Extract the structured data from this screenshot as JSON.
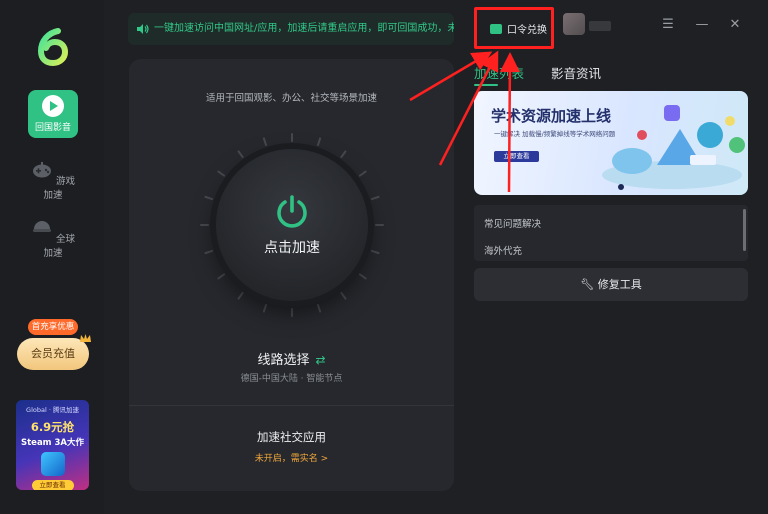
{
  "sidebar": {
    "items": [
      {
        "label": "回国影音",
        "icon": "play-icon",
        "active": true
      },
      {
        "label": "游戏加速",
        "icon": "gamepad-icon",
        "active": false
      },
      {
        "label": "全球加速",
        "icon": "globe-icon",
        "active": false
      }
    ],
    "promo_badge": "首充享优惠",
    "vip_button": "会员充值",
    "ad": {
      "brand": "Global · 腾讯加速",
      "price": "6.9元抢",
      "title": "Steam 3A大作",
      "cta": "立即查看"
    }
  },
  "notice": "一键加速访问中国网址/应用，加速后请重启应用，即可回国成功，未开启",
  "main": {
    "scenario": "适用于回国观影、办公、社交等场景加速",
    "power_label": "点击加速",
    "route_title": "线路选择",
    "route_sub": "德国-中国大陆 · 智能节点",
    "social_title": "加速社交应用",
    "social_sub": "未开启，需实名 >"
  },
  "header": {
    "redeem": "口令兑换",
    "window_buttons": {
      "menu": "☰",
      "minimize": "—",
      "close": "✕"
    }
  },
  "right": {
    "tabs": [
      {
        "label": "加速列表",
        "active": true
      },
      {
        "label": "影音资讯",
        "active": false
      }
    ],
    "banner": {
      "title": "学术资源加速上线",
      "subtitle": "一键解决 加载慢/频繁掉线等学术网络问题",
      "button": "立即查看"
    },
    "faq": [
      "常见问题解决",
      "海外代充"
    ],
    "repair_tool": "修复工具"
  },
  "colors": {
    "accent": "#30c184",
    "annotation": "#ff2020",
    "warning": "#f0a63b"
  }
}
